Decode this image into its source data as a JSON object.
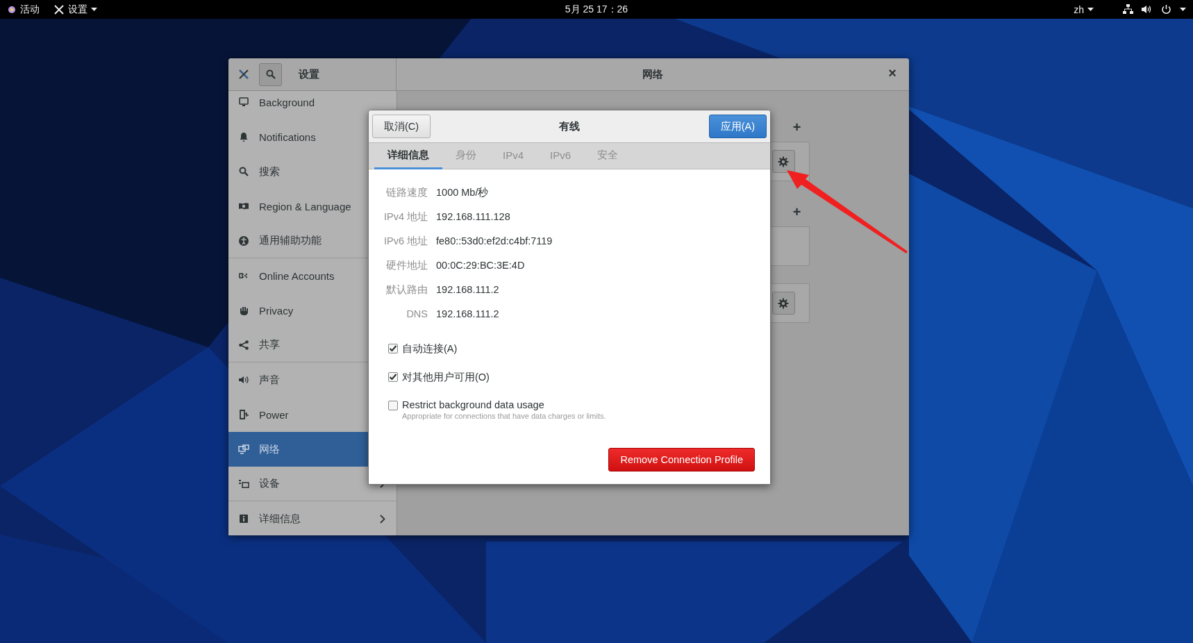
{
  "top_bar": {
    "activities": "活动",
    "app_menu": "设置",
    "clock": "5月 25  17：26",
    "input_method": "zh"
  },
  "settings_window": {
    "sidebar_title": "设置",
    "title": "网络",
    "close": "×",
    "sidebar": {
      "items": [
        {
          "label": "Background",
          "selected": false
        },
        {
          "label": "Notifications",
          "selected": false
        },
        {
          "label": "搜索",
          "selected": false
        },
        {
          "label": "Region & Language",
          "selected": false
        },
        {
          "label": "通用辅助功能",
          "selected": false,
          "divider": true
        },
        {
          "label": "Online Accounts",
          "selected": false
        },
        {
          "label": "Privacy",
          "selected": false
        },
        {
          "label": "共享",
          "selected": false,
          "divider": true
        },
        {
          "label": "声音",
          "selected": false
        },
        {
          "label": "Power",
          "selected": false
        },
        {
          "label": "网络",
          "selected": true
        },
        {
          "label": "设备",
          "selected": false,
          "chevron": true,
          "divider": true
        },
        {
          "label": "详细信息",
          "selected": false,
          "chevron": true
        }
      ]
    },
    "panel": {
      "rows": [
        {
          "kind": "add",
          "label": "+"
        },
        {
          "kind": "gear"
        },
        {
          "kind": "add",
          "label": "+"
        },
        {
          "kind": "empty"
        },
        {
          "kind": "gear"
        }
      ]
    }
  },
  "dialog": {
    "cancel": "取消(C)",
    "title": "有线",
    "apply": "应用(A)",
    "tabs": [
      {
        "label": "详细信息",
        "selected": true
      },
      {
        "label": "身份",
        "selected": false
      },
      {
        "label": "IPv4",
        "selected": false
      },
      {
        "label": "IPv6",
        "selected": false
      },
      {
        "label": "安全",
        "selected": false
      }
    ],
    "details": [
      {
        "label": "链路速度",
        "value": "1000 Mb/秒"
      },
      {
        "label": "IPv4 地址",
        "value": "192.168.111.128"
      },
      {
        "label": "IPv6 地址",
        "value": "fe80::53d0:ef2d:c4bf:7119"
      },
      {
        "label": "硬件地址",
        "value": "00:0C:29:BC:3E:4D"
      },
      {
        "label": "默认路由",
        "value": "192.168.111.2"
      },
      {
        "label": "DNS",
        "value": "192.168.111.2"
      }
    ],
    "options": [
      {
        "label": "自动连接(A)",
        "checked": true
      },
      {
        "label": "对其他用户可用(O)",
        "checked": true
      },
      {
        "label": "Restrict background data usage",
        "hint": "Appropriate for connections that have data charges or limits.",
        "checked": false
      }
    ],
    "remove": "Remove Connection Profile"
  }
}
